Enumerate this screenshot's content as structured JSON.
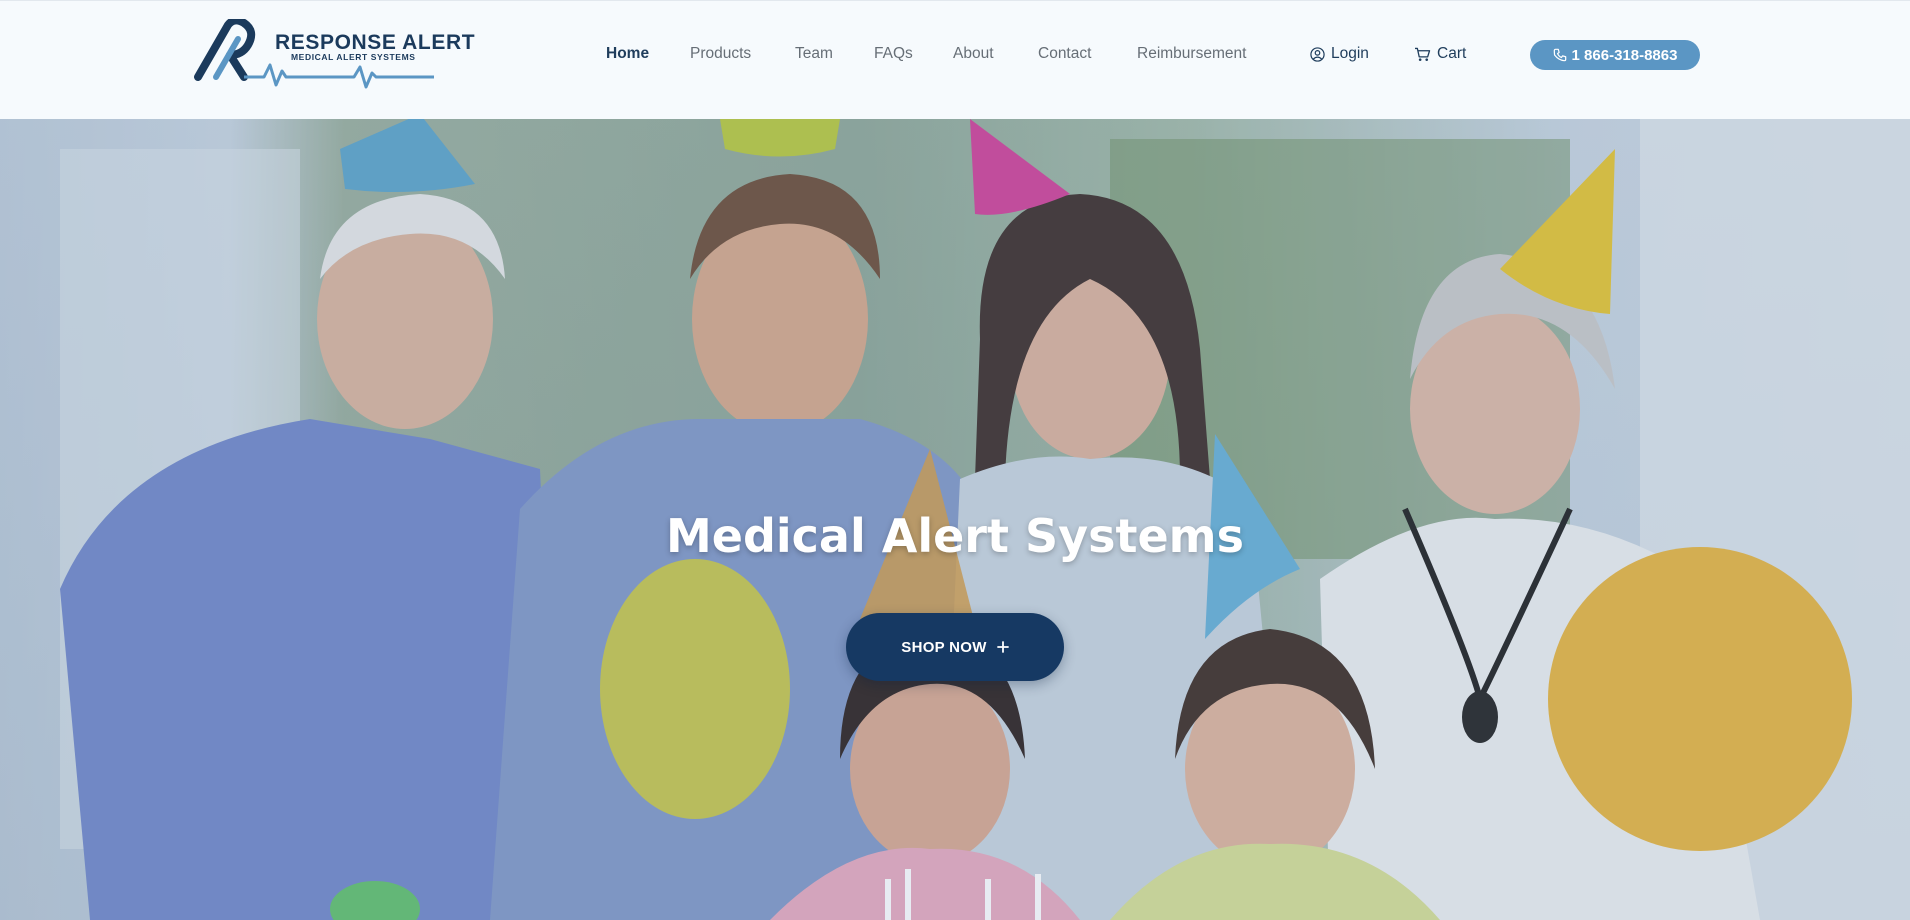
{
  "brand": {
    "title": "RESPONSE ALERT",
    "subtitle": "MEDICAL ALERT SYSTEMS",
    "logo_icon": "ra-monogram-heartbeat"
  },
  "nav": {
    "items": [
      {
        "label": "Home",
        "active": true
      },
      {
        "label": "Products",
        "active": false
      },
      {
        "label": "Team",
        "active": false
      },
      {
        "label": "FAQs",
        "active": false
      },
      {
        "label": "About",
        "active": false
      },
      {
        "label": "Contact",
        "active": false
      },
      {
        "label": "Reimbursement",
        "active": false
      }
    ],
    "login_label": "Login",
    "login_icon": "user-circle-icon",
    "cart_label": "Cart",
    "cart_icon": "cart-icon",
    "phone_label": "1 866-318-8863",
    "phone_icon": "phone-icon"
  },
  "hero": {
    "title": "Medical Alert Systems",
    "cta_label": "SHOP NOW",
    "cta_icon": "plus-icon",
    "image_description_icon": "family-party-photo"
  },
  "colors": {
    "brand_navy": "#1b3a5c",
    "accent_blue": "#5b96c4",
    "cta_navy": "#163963",
    "nav_gray": "#666e76"
  }
}
